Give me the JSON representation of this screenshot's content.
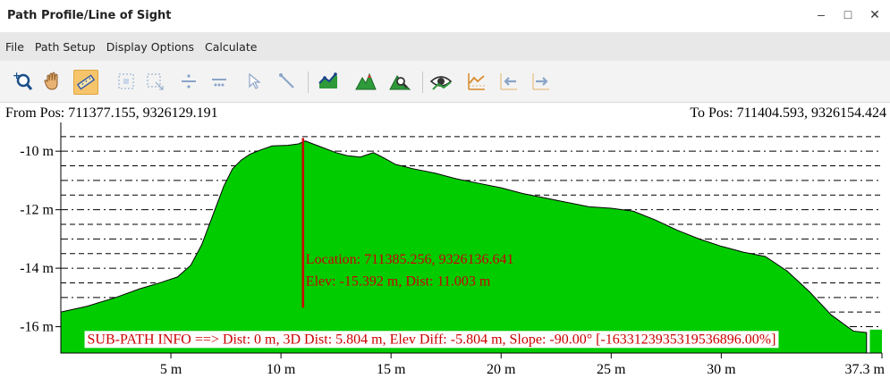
{
  "window": {
    "title": "Path Profile/Line of Sight",
    "minimize": "–",
    "maximize": "□",
    "close": "✕"
  },
  "menu": [
    "File",
    "Path Setup",
    "Display Options",
    "Calculate"
  ],
  "toolbar": {
    "icons": [
      "zoom-in-icon",
      "pan-hand-icon",
      "ruler-measure-icon",
      "zoom-box-icon",
      "zoom-extents-icon",
      "divide-icon",
      "divide-points-icon",
      "select-arrow-icon",
      "line-select-icon",
      "profile-chart-icon",
      "terrain-peaks-icon",
      "terrain-search-icon",
      "eye-view-icon",
      "profile-graph-icon",
      "prev-profile-icon",
      "next-profile-icon"
    ],
    "active": "ruler-measure-icon"
  },
  "from_pos": "From Pos: 711377.155, 9326129.191",
  "to_pos": "To Pos: 711404.593, 9326154.424",
  "colors": {
    "fill": "#00cc00",
    "stroke": "#000000",
    "cursor": "#cc0000"
  },
  "chart_data": {
    "type": "area",
    "xlabel": "",
    "ylabel": "",
    "xlim": [
      0,
      37.3
    ],
    "ylim": [
      -16.9,
      -9.2
    ],
    "x_ticks": [
      5,
      10,
      15,
      20,
      25,
      30,
      37.3
    ],
    "x_tick_labels": [
      "5 m",
      "10 m",
      "15 m",
      "20 m",
      "25 m",
      "30 m",
      "37.3 m"
    ],
    "y_ticks": [
      -10,
      -12,
      -14,
      -16
    ],
    "y_tick_labels": [
      "-10 m",
      "-12 m",
      "-14 m",
      "-16 m"
    ],
    "grid_dashed_y": [
      -9.5,
      -10,
      -10.5,
      -11,
      -11.5,
      -12,
      -12.5,
      -13,
      -13.5,
      -14,
      -14.5,
      -15,
      -15.5,
      -16
    ],
    "series": [
      {
        "x": [
          0,
          1.2,
          2.5,
          3.6,
          4.5,
          5.3,
          5.9,
          6.4,
          6.9,
          7.4,
          7.8,
          8.2,
          8.6,
          9.1,
          9.6,
          10.3,
          10.8,
          11.1,
          11.8,
          12.5,
          13.0,
          13.6,
          14.2,
          14.6,
          15.2,
          16.0,
          17.0,
          18.0,
          19.0,
          20.0,
          21.0,
          22.0,
          23.0,
          24.0,
          25.0,
          26.0,
          27.0,
          28.0,
          29.0,
          30.0,
          31.0,
          32.0,
          33.0,
          34.0,
          35.0,
          36.0,
          36.6
        ],
        "y": [
          -15.5,
          -15.3,
          -15.0,
          -14.7,
          -14.5,
          -14.3,
          -13.9,
          -13.2,
          -12.2,
          -11.2,
          -10.6,
          -10.3,
          -10.1,
          -9.95,
          -9.82,
          -9.8,
          -9.75,
          -9.65,
          -9.85,
          -10.05,
          -10.15,
          -10.2,
          -10.05,
          -10.2,
          -10.45,
          -10.6,
          -10.75,
          -10.95,
          -11.1,
          -11.25,
          -11.45,
          -11.6,
          -11.75,
          -11.9,
          -11.95,
          -12.05,
          -12.35,
          -12.7,
          -13.0,
          -13.25,
          -13.45,
          -13.6,
          -14.1,
          -14.8,
          -15.6,
          -16.15,
          -16.2
        ]
      }
    ],
    "cursor": {
      "x": 11.003,
      "y_top": -9.55,
      "y_bottom": -15.35,
      "location_label": "Location: 711385.256, 9326136.641",
      "elev_label": "Elev: -15.392 m, Dist: 11.003 m"
    },
    "subpath_info": "SUB-PATH INFO ==> Dist: 0 m, 3D Dist: 5.804 m, Elev Diff: -5.804 m, Slope: -90.00° [-1633123935319536896.00%]"
  }
}
